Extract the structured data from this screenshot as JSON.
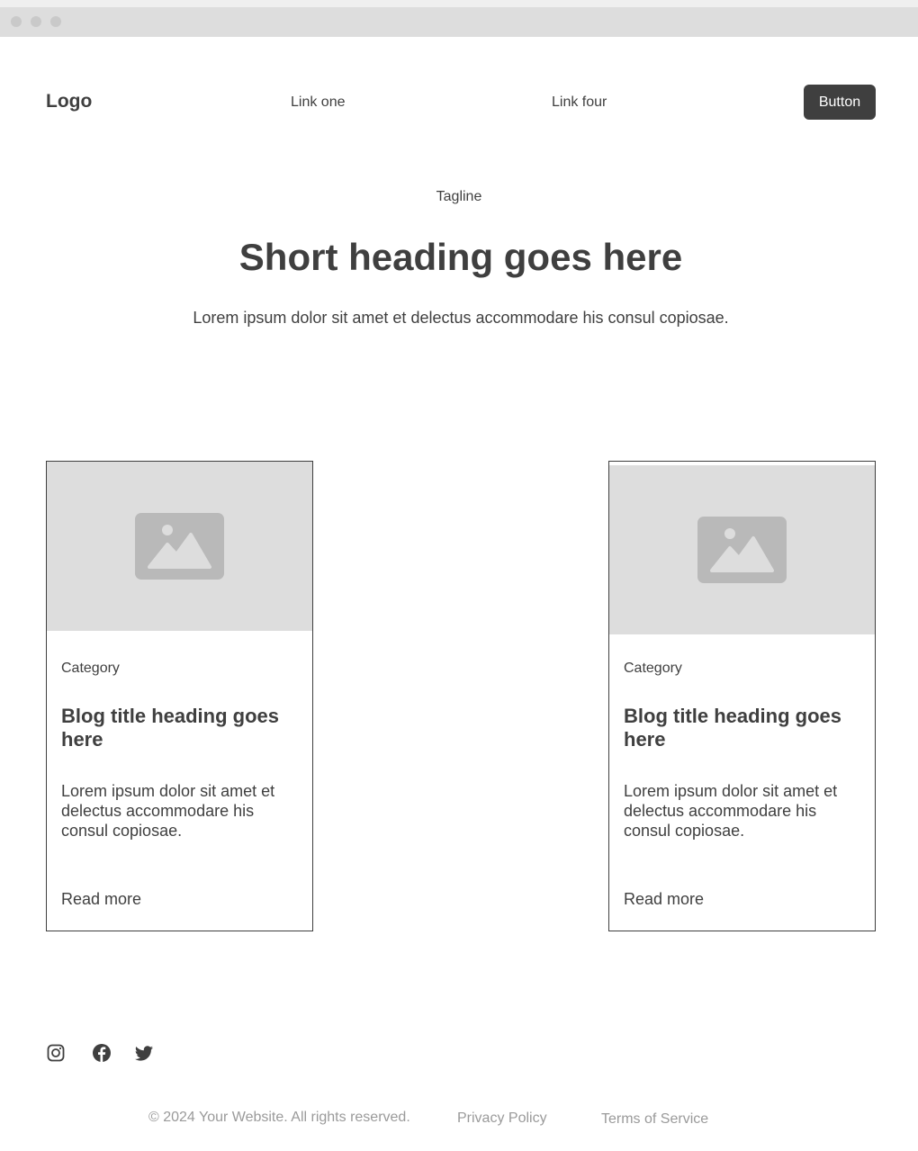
{
  "header": {
    "logo": "Logo",
    "nav_links": [
      "Link one",
      "Link four"
    ],
    "button_label": "Button"
  },
  "hero": {
    "tagline": "Tagline",
    "heading": "Short heading goes here",
    "text": "Lorem ipsum dolor sit amet et delectus accommodare his consul copiosae."
  },
  "cards": [
    {
      "image_icon": "image-placeholder-icon",
      "category": "Category",
      "title": "Blog title heading goes here",
      "text": "Lorem ipsum dolor sit amet et delectus accommodare his consul copiosae.",
      "link": "Read more"
    },
    {
      "image_icon": "image-placeholder-icon",
      "category": "Category",
      "title": "Blog title heading goes here",
      "text": "Lorem ipsum dolor sit amet et delectus accommodare his consul copiosae.",
      "link": "Read more"
    }
  ],
  "footer": {
    "social_icons": [
      "instagram-icon",
      "facebook-icon",
      "twitter-icon"
    ],
    "copyright": "© 2024 Your Website. All rights reserved.",
    "privacy": "Privacy Policy",
    "terms": "Terms of Service"
  },
  "colors": {
    "text": "#3f3f3f",
    "placeholder_bg": "#dddddd",
    "placeholder_icon": "#b9b9b9",
    "footer_text": "#9a9a9a",
    "button_bg": "#3f3f3f"
  }
}
